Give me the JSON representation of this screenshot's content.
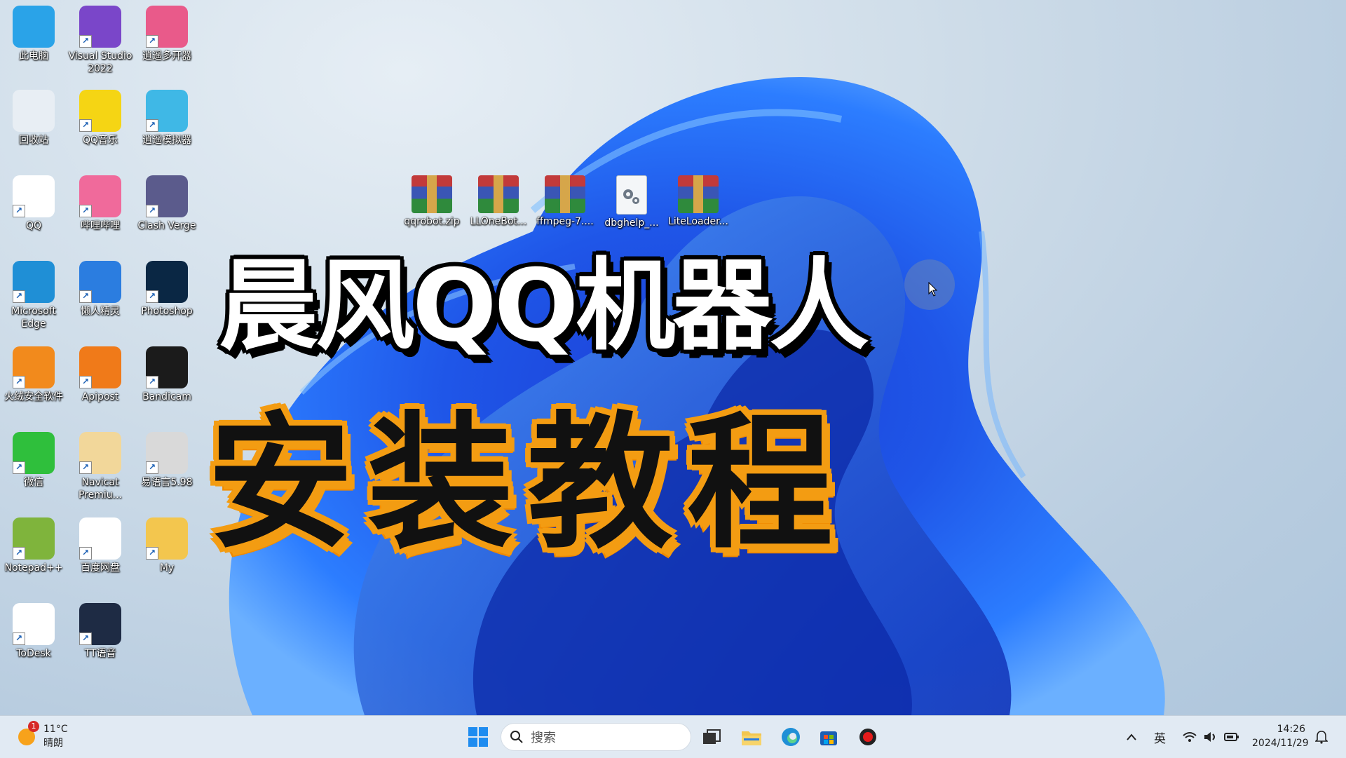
{
  "desktop": {
    "icons": [
      {
        "label": "此电脑",
        "icon": "computer-icon",
        "color": "#2aa3e8"
      },
      {
        "label": "Visual Studio 2022",
        "icon": "visual-studio-icon",
        "color": "#7a46c9"
      },
      {
        "label": "逍遥多开器",
        "icon": "xiaoyao-multi-icon",
        "color": "#e95a8a"
      },
      {
        "label": "回收站",
        "icon": "recycle-bin-icon",
        "color": "#e8eef4"
      },
      {
        "label": "QQ音乐",
        "icon": "qq-music-icon",
        "color": "#f5d514"
      },
      {
        "label": "逍遥模拟器",
        "icon": "xiaoyao-emulator-icon",
        "color": "#3fb8e6"
      },
      {
        "label": "QQ",
        "icon": "qq-penguin-icon",
        "color": "#ffffff"
      },
      {
        "label": "哔哩哔哩",
        "icon": "bilibili-icon",
        "color": "#f06a9b"
      },
      {
        "label": "Clash Verge",
        "icon": "clash-verge-icon",
        "color": "#5b5b8c"
      },
      {
        "label": "Microsoft Edge",
        "icon": "edge-icon",
        "color": "#1f8fd6"
      },
      {
        "label": "懒人精灵",
        "icon": "lanren-icon",
        "color": "#2b7de0"
      },
      {
        "label": "Photoshop",
        "icon": "photoshop-icon",
        "color": "#0a2744"
      },
      {
        "label": "火绒安全软件",
        "icon": "huorong-icon",
        "color": "#f28a1c"
      },
      {
        "label": "Apipost",
        "icon": "apipost-icon",
        "color": "#f07a19"
      },
      {
        "label": "Bandicam",
        "icon": "bandicam-icon",
        "color": "#1b1b1b"
      },
      {
        "label": "微信",
        "icon": "wechat-icon",
        "color": "#2fbf3c"
      },
      {
        "label": "Navicat Premiu...",
        "icon": "navicat-icon",
        "color": "#f2d79a"
      },
      {
        "label": "易语言5.98",
        "icon": "eyuyan-icon",
        "color": "#d9d9d9"
      },
      {
        "label": "Notepad++",
        "icon": "notepad-plus-icon",
        "color": "#7fb43c"
      },
      {
        "label": "百度网盘",
        "icon": "baidu-netdisk-icon",
        "color": "#ffffff"
      },
      {
        "label": "My",
        "icon": "folder-icon",
        "color": "#f3c64e"
      },
      {
        "label": "ToDesk",
        "icon": "todesk-icon",
        "color": "#ffffff"
      },
      {
        "label": "TT语音",
        "icon": "tt-voice-icon",
        "color": "#1e2b44"
      }
    ],
    "files": [
      {
        "label": "qqrobot.zip",
        "icon": "winrar-archive-icon"
      },
      {
        "label": "LLOneBot...",
        "icon": "winrar-archive-icon"
      },
      {
        "label": "ffmpeg-7....",
        "icon": "winrar-archive-icon"
      },
      {
        "label": "dbghelp_...",
        "icon": "settings-file-icon"
      },
      {
        "label": "LiteLoader...",
        "icon": "winrar-archive-icon"
      }
    ]
  },
  "overlay": {
    "title_line1": "晨风QQ机器人",
    "title_line2": "安装教程",
    "accent": "#f39c12"
  },
  "taskbar": {
    "weather": {
      "temp": "11°C",
      "condition": "晴朗",
      "badge": "1"
    },
    "search_placeholder": "搜索",
    "apps": [
      "start-icon",
      "task-view-icon",
      "file-explorer-icon",
      "edge-icon",
      "store-icon",
      "record-icon"
    ],
    "tray": {
      "ime": "英"
    },
    "clock": {
      "time": "14:26",
      "date": "2024/11/29"
    }
  }
}
